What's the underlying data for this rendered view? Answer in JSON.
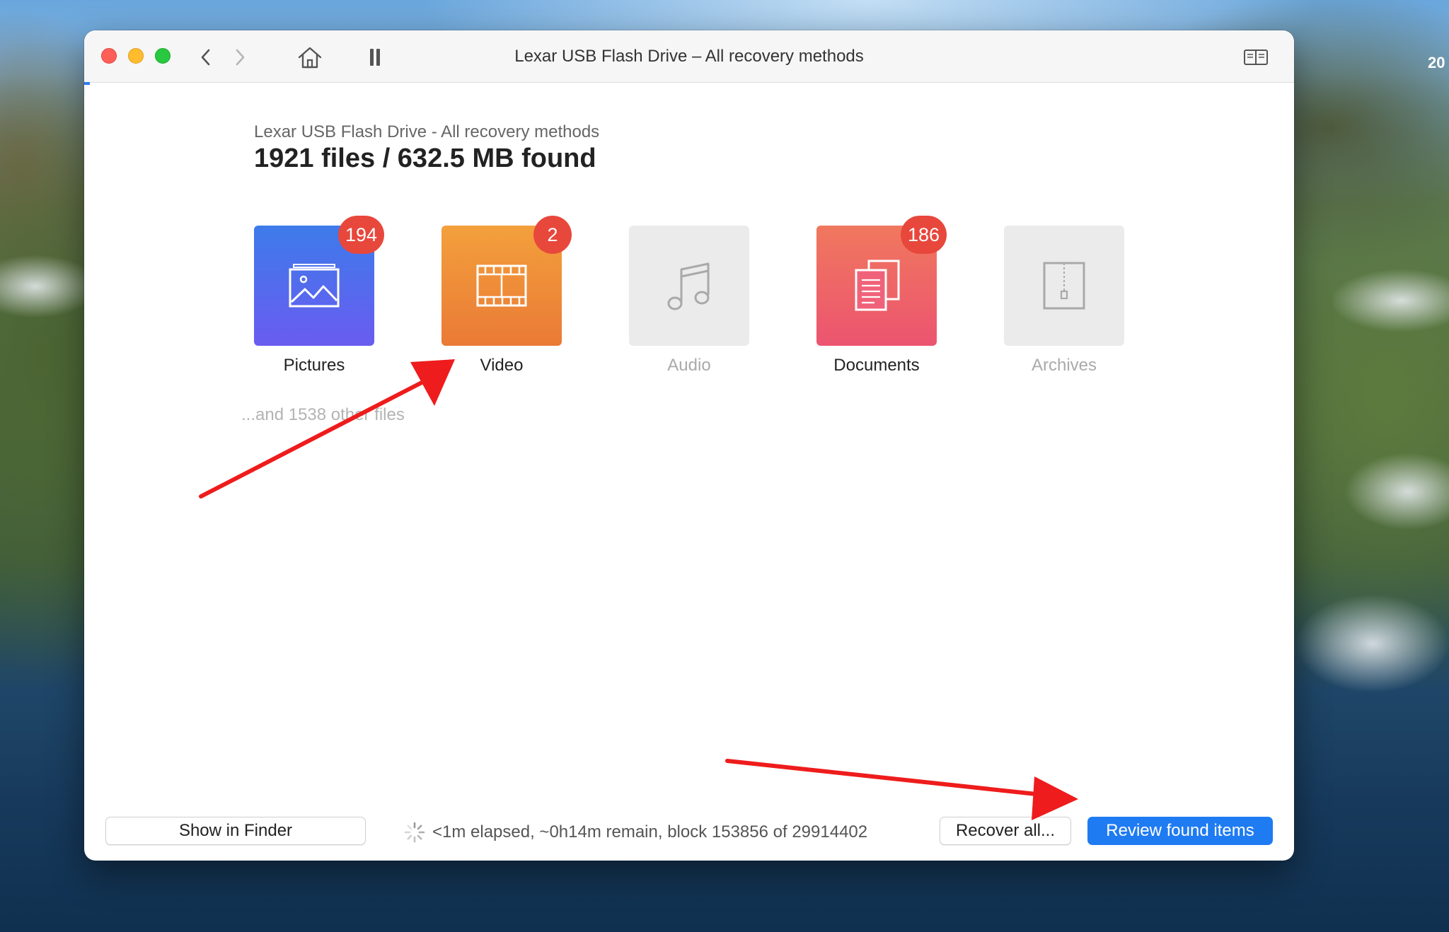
{
  "desktop": {
    "clock_fragment": "20"
  },
  "window": {
    "title": "Lexar USB Flash Drive – All recovery methods"
  },
  "scan": {
    "subtitle": "Lexar USB Flash Drive - All recovery methods",
    "summary": "1921 files / 632.5 MB found",
    "other_files": "...and 1538 other files"
  },
  "categories": [
    {
      "label": "Pictures",
      "count": "194",
      "enabled": true,
      "icon": "picture-icon"
    },
    {
      "label": "Video",
      "count": "2",
      "enabled": true,
      "icon": "film-icon"
    },
    {
      "label": "Audio",
      "count": "",
      "enabled": false,
      "icon": "music-note-icon"
    },
    {
      "label": "Documents",
      "count": "186",
      "enabled": true,
      "icon": "documents-icon"
    },
    {
      "label": "Archives",
      "count": "",
      "enabled": false,
      "icon": "zip-archive-icon"
    }
  ],
  "footer": {
    "show_in_finder": "Show in Finder",
    "status": "<1m elapsed, ~0h14m remain, block 153856 of 29914402",
    "recover_all": "Recover all...",
    "review": "Review found items"
  },
  "colors": {
    "accent_blue": "#1f7bf2",
    "badge_red": "#e8473c",
    "arrow_red": "#ee1c1c"
  }
}
